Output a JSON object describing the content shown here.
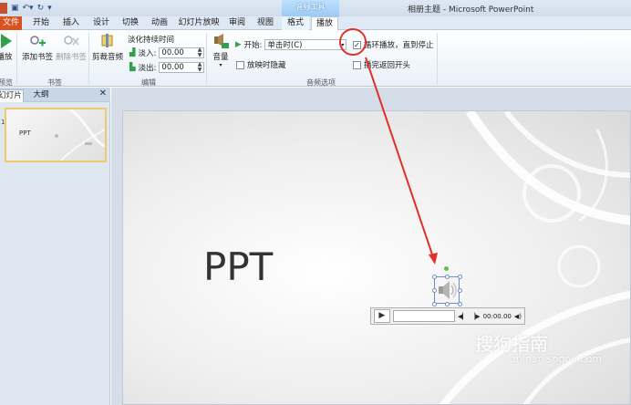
{
  "window": {
    "title": "相册主题 - Microsoft PowerPoint",
    "context_group": "音频工具"
  },
  "tabs": [
    {
      "label": "文件"
    },
    {
      "label": "开始"
    },
    {
      "label": "插入"
    },
    {
      "label": "设计"
    },
    {
      "label": "切换"
    },
    {
      "label": "动画"
    },
    {
      "label": "幻灯片放映"
    },
    {
      "label": "审阅"
    },
    {
      "label": "视图"
    },
    {
      "label": "格式"
    },
    {
      "label": "播放"
    }
  ],
  "ribbon": {
    "preview": {
      "button": "播放",
      "group": "预览"
    },
    "bookmarks": {
      "add": "添加书签",
      "remove": "删除书签",
      "group": "书签"
    },
    "editing": {
      "trim": "剪裁音频",
      "fade_title": "淡化持续时间",
      "fade_in_label": "淡入:",
      "fade_in_value": "00.00",
      "fade_out_label": "淡出:",
      "fade_out_value": "00.00",
      "group": "编辑"
    },
    "audio_options": {
      "volume": "音量",
      "start_label": "开始:",
      "start_value": "单击时(C)",
      "hide_label": "放映时隐藏",
      "loop_label": "循环播放，直到停止",
      "rewind_label": "播完返回开头",
      "group": "音频选项"
    }
  },
  "left_pane": {
    "tab_slides": "幻灯片",
    "tab_outline": "大纲",
    "close": "✕",
    "thumb_number": "1",
    "thumb_title": "PPT"
  },
  "slide": {
    "title": "PPT",
    "player_time": "00:00.00"
  },
  "watermark": {
    "brand": "搜狗指南",
    "url": "zhinan.sogou.com"
  },
  "colors": {
    "file_tab": "#d9531e",
    "annotation": "#e0302a",
    "context_tab": "#9ccaf2"
  }
}
